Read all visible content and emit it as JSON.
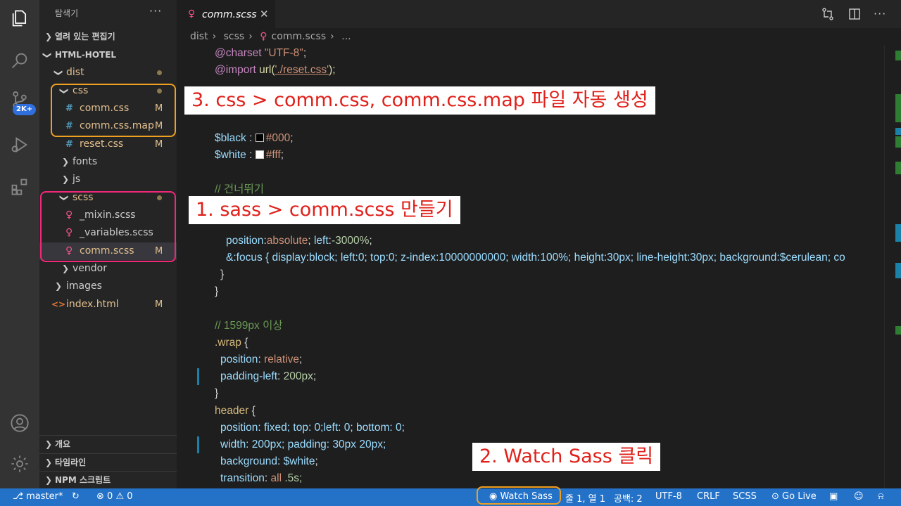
{
  "activity": {
    "badge": "2K+"
  },
  "sidebar": {
    "title": "탐색기",
    "more": "···",
    "open_editors": "열려 있는 편집기",
    "project": "HTML-HOTEL",
    "tree": {
      "dist": "dist",
      "css": "css",
      "comm_css": "comm.css",
      "comm_css_map": "comm.css.map",
      "reset_css": "reset.css",
      "fonts": "fonts",
      "js": "js",
      "scss": "scss",
      "mixin": "_mixin.scss",
      "variables": "_variables.scss",
      "comm_scss": "comm.scss",
      "vendor": "vendor",
      "images": "images",
      "index": "index.html",
      "modified": "M"
    },
    "outline": "개요",
    "timeline": "타임라인",
    "npm": "NPM 스크립트"
  },
  "editor": {
    "tab": "comm.scss",
    "breadcrumb": [
      "dist",
      "scss",
      "comm.scss",
      "..."
    ]
  },
  "code": {
    "l1a": "@charset",
    "l1b": " \"UTF-8\"",
    "l1c": ";",
    "l2a": "@import",
    "l2b": " url(",
    "l2c": "'./reset.css'",
    "l2d": ");",
    "l3a": "$black",
    "l3b": " : ",
    "l3c": "#000",
    "l3d": ";",
    "l4a": "$white",
    "l4b": " : ",
    "l4c": "#fff",
    "l4d": ";",
    "l5": "// 건너뛰기",
    "l6a": "position",
    "l6b": ":",
    "l6c": "absolute",
    "l6d": "; ",
    "l6e": "left",
    "l6f": ":",
    "l6g": "-3000%",
    "l6h": ";",
    "l7": "&:focus { display:block; left:0; top:0; z-index:10000000000; width:100%; height:30px; line-height:30px; background:$cerulean; co",
    "l8": "}",
    "l9": "}",
    "l10": "// 1599px 이상",
    "l11a": ".wrap",
    "l11b": " {",
    "l12a": "position",
    "l12b": ": ",
    "l12c": "relative",
    "l12d": ";",
    "l13a": "padding-left",
    "l13b": ": ",
    "l13c": "200px",
    "l13d": ";",
    "l14": "}",
    "l15a": "header",
    "l15b": " {",
    "l16": "position: fixed; top: 0;left: 0; bottom: 0;",
    "l17": "width: 200px; padding: 30px 20px;",
    "l18a": "background",
    "l18b": ": ",
    "l18c": "$white",
    "l18d": ";",
    "l19a": "transition",
    "l19b": ": ",
    "l19c": "all",
    "l19d": " .5s;"
  },
  "annotations": {
    "note1": "1. sass > comm.scss 만들기",
    "note2": "2. Watch Sass  클릭",
    "note3": "3. css > comm.css, comm.css.map 파일 자동 생성"
  },
  "status": {
    "branch": "master*",
    "errors": "0",
    "warnings": "0",
    "watch": "Watch Sass",
    "position": "줄 1, 열 1",
    "spaces": "공백: 2",
    "encoding": "UTF-8",
    "eol": "CRLF",
    "language": "SCSS",
    "golive": "Go Live"
  },
  "colors": {
    "accent": "#2472c8",
    "highlight_orange": "#f0a020",
    "highlight_pink": "#f0287a",
    "note_text": "#e0201a"
  }
}
